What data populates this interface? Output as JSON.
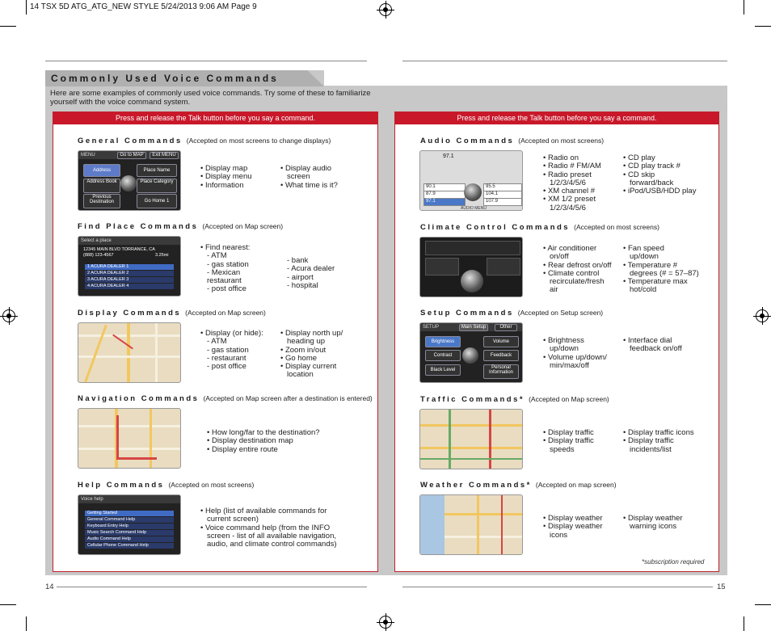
{
  "slug": "14 TSX 5D ATG_ATG_NEW STYLE  5/24/2013  9:06 AM  Page 9",
  "title": "Commonly Used Voice Commands",
  "intro": "Here are some examples of commonly used voice commands. Try some of these to familiarize yourself with the voice command system.",
  "left": {
    "header": "Press and release the Talk button before you say a command.",
    "sections": [
      {
        "title": "General Commands",
        "note": "(Accepted on most screens to change displays)",
        "col1": [
          "Display map",
          "Display menu",
          "Information"
        ],
        "col2": [
          "Display audio\nscreen",
          "What time is it?"
        ]
      },
      {
        "title": "Find Place Commands",
        "note": "(Accepted on Map screen)",
        "col1": [
          "Find nearest:\n- ATM\n- gas station\n- Mexican\n   restaurant\n- post office"
        ],
        "col2": [
          "- bank\n- Acura dealer\n- airport\n- hospital"
        ]
      },
      {
        "title": "Display Commands",
        "note": "(Accepted on Map screen)",
        "col1": [
          "Display (or hide):\n- ATM\n- gas station\n- restaurant\n- post office"
        ],
        "col2": [
          "Display north up/\nheading up",
          "Zoom in/out",
          "Go home",
          "Display current\nlocation"
        ]
      },
      {
        "title": "Navigation Commands",
        "note": "(Accepted on Map screen after a destination is entered)",
        "col1": [
          "How long/far to the destination?",
          "Display destination map",
          "Display entire route"
        ],
        "col2": []
      },
      {
        "title": "Help Commands",
        "note": "(Accepted on most screens)",
        "col1": [
          "Help (list of available commands for\ncurrent screen)",
          "Voice command help (from the INFO\nscreen - list of all available navigation,\naudio, and climate control commands)"
        ],
        "col2": []
      }
    ],
    "screens": {
      "menu": {
        "bar": "MENU",
        "tabs": [
          "Go to MAP",
          "Exit MENU"
        ],
        "buttons": [
          "Address",
          "Place Name",
          "Address Book",
          "Place Category",
          "Previous Destination",
          "Go Home 1"
        ]
      },
      "place": {
        "bar": "Select a place",
        "address": "12345 MAIN BLVD TORRANCE, CA",
        "phone": "(888) 123-4567",
        "dist": "3.25mi",
        "rows": [
          "1 ACURA DEALER 1",
          "2 ACURA DEALER 2",
          "3 ACURA DEALER 3",
          "4 ACURA DEALER 4"
        ]
      },
      "help": {
        "bar": "Voice help",
        "rows": [
          "Getting Started",
          "General Command Help",
          "Keyboard Entry Help",
          "Music Search Command Help",
          "Audio Command Help",
          "Cellular Phone Command Help"
        ]
      }
    },
    "page_number": "14"
  },
  "right": {
    "header": "Press and release the Talk button before you say a command.",
    "sections": [
      {
        "title": "Audio Commands",
        "note": "(Accepted on most screens)",
        "col1": [
          "Radio on",
          "Radio # FM/AM",
          "Radio preset\n1/2/3/4/5/6",
          "XM channel #",
          "XM 1/2 preset\n1/2/3/4/5/6"
        ],
        "col2": [
          "CD play",
          "CD play track #",
          "CD skip\nforward/back",
          "iPod/USB/HDD play"
        ]
      },
      {
        "title": "Climate Control Commands",
        "note": "(Accepted on most screens)",
        "col1": [
          "Air conditioner\non/off",
          "Rear defrost on/off",
          "Climate control\nrecirculate/fresh\nair"
        ],
        "col2": [
          "Fan speed\nup/down",
          "Temperature #\ndegrees (# = 57–87)",
          "Temperature max\nhot/cold"
        ]
      },
      {
        "title": "Setup Commands",
        "note": "(Accepted on Setup screen)",
        "col1": [
          "Brightness\nup/down",
          "Volume up/down/\nmin/max/off"
        ],
        "col2": [
          "Interface dial\nfeedback on/off"
        ]
      },
      {
        "title": "Traffic Commands*",
        "note": "(Accepted on Map screen)",
        "col1": [
          "Display traffic",
          "Display traffic\nspeeds"
        ],
        "col2": [
          "Display traffic icons",
          "Display traffic\nincidents/list"
        ]
      },
      {
        "title": "Weather Commands*",
        "note": "(Accepted on map screen)",
        "col1": [
          "Display weather",
          "Display weather\nicons"
        ],
        "col2": [
          "Display weather\nwarning icons"
        ]
      }
    ],
    "screens": {
      "audio": {
        "freq": "97.1",
        "presets": [
          "90.1",
          "87.9",
          "97.1",
          "95.5",
          "104.1",
          "107.9"
        ],
        "bottom": "AUDIO MENU"
      },
      "setup": {
        "bar": "SETUP",
        "tabs": [
          "Main Setup",
          "Other"
        ],
        "buttons": [
          "Brightness",
          "Volume",
          "Contrast",
          "Feedback",
          "Black Level",
          "Personal Information"
        ]
      }
    },
    "footnote": "*subscription required",
    "page_number": "15"
  }
}
